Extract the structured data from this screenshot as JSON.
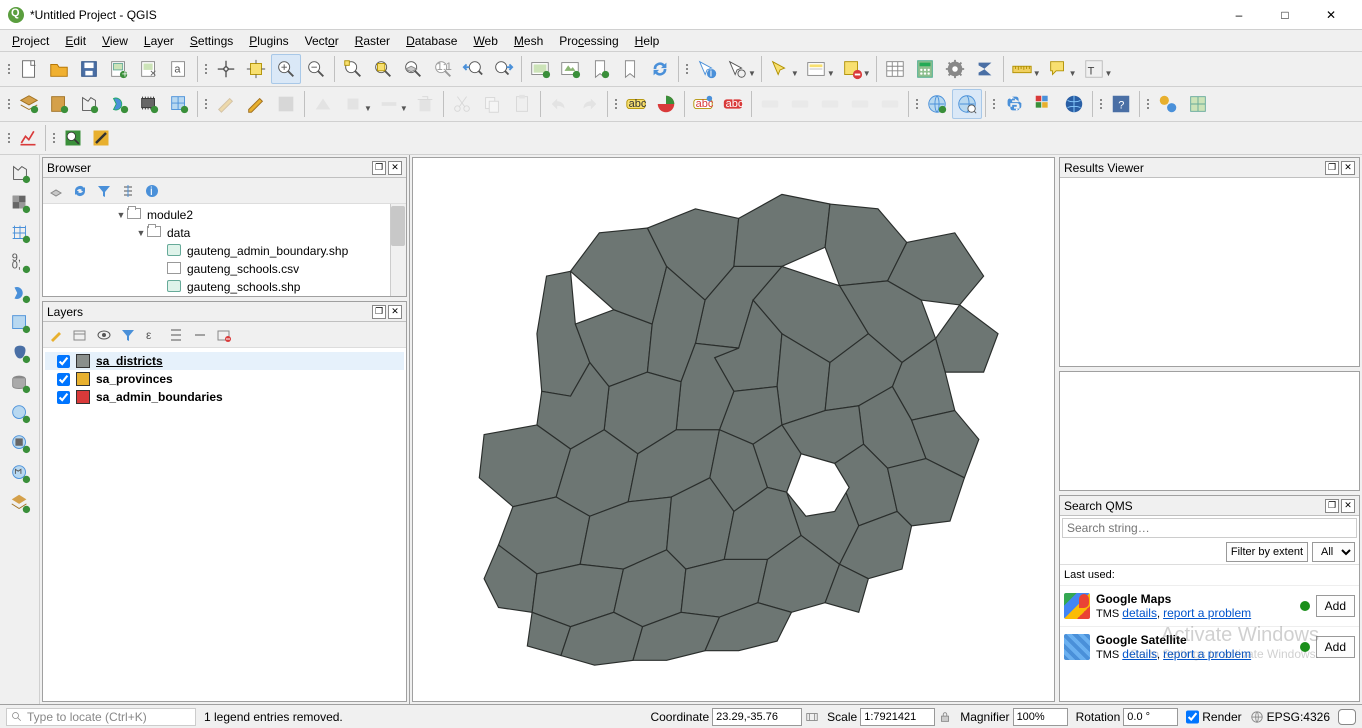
{
  "window": {
    "title": "*Untitled Project - QGIS"
  },
  "menubar": [
    "Project",
    "Edit",
    "View",
    "Layer",
    "Settings",
    "Plugins",
    "Vector",
    "Raster",
    "Database",
    "Web",
    "Mesh",
    "Processing",
    "Help"
  ],
  "panels": {
    "browser": {
      "title": "Browser",
      "tree": [
        {
          "indent": 0,
          "caret": "▼",
          "icon": "folder",
          "label": "module2"
        },
        {
          "indent": 1,
          "caret": "▼",
          "icon": "folder",
          "label": "data"
        },
        {
          "indent": 2,
          "caret": "",
          "icon": "shp",
          "label": "gauteng_admin_boundary.shp"
        },
        {
          "indent": 2,
          "caret": "",
          "icon": "csv",
          "label": "gauteng_schools.csv"
        },
        {
          "indent": 2,
          "caret": "",
          "icon": "shp",
          "label": "gauteng_schools.shp"
        }
      ]
    },
    "layers": {
      "title": "Layers",
      "items": [
        {
          "checked": true,
          "color": "#8a8f8c",
          "name": "sa_districts",
          "selected": true,
          "bold": true,
          "underline": true
        },
        {
          "checked": true,
          "color": "#e8b02e",
          "name": "sa_provinces",
          "selected": false,
          "bold": true,
          "underline": false
        },
        {
          "checked": true,
          "color": "#d93a3a",
          "name": "sa_admin_boundaries",
          "selected": false,
          "bold": true,
          "underline": false
        }
      ]
    },
    "results": {
      "title": "Results Viewer"
    },
    "qms": {
      "title": "Search QMS",
      "placeholder": "Search string…",
      "filter_btn": "Filter by extent",
      "filter_sel": "All",
      "last_used_label": "Last used:",
      "items": [
        {
          "icon": "gm",
          "title": "Google Maps",
          "prefix": "TMS",
          "link1": "details",
          "link2": "report a problem",
          "add": "Add"
        },
        {
          "icon": "gs",
          "title": "Google Satellite",
          "prefix": "TMS",
          "link1": "details",
          "link2": "report a problem",
          "add": "Add"
        }
      ]
    }
  },
  "statusbar": {
    "locate_placeholder": "Type to locate (Ctrl+K)",
    "message": "1 legend entries removed.",
    "coord_label": "Coordinate",
    "coord_value": "23.29,-35.76",
    "scale_label": "Scale",
    "scale_value": "1:7921421",
    "mag_label": "Magnifier",
    "mag_value": "100%",
    "rot_label": "Rotation",
    "rot_value": "0.0 °",
    "render_label": "Render",
    "epsg": "EPSG:4326"
  },
  "watermark": {
    "line1": "Activate Windows",
    "line2": "Go to Settings to activate Windows."
  }
}
